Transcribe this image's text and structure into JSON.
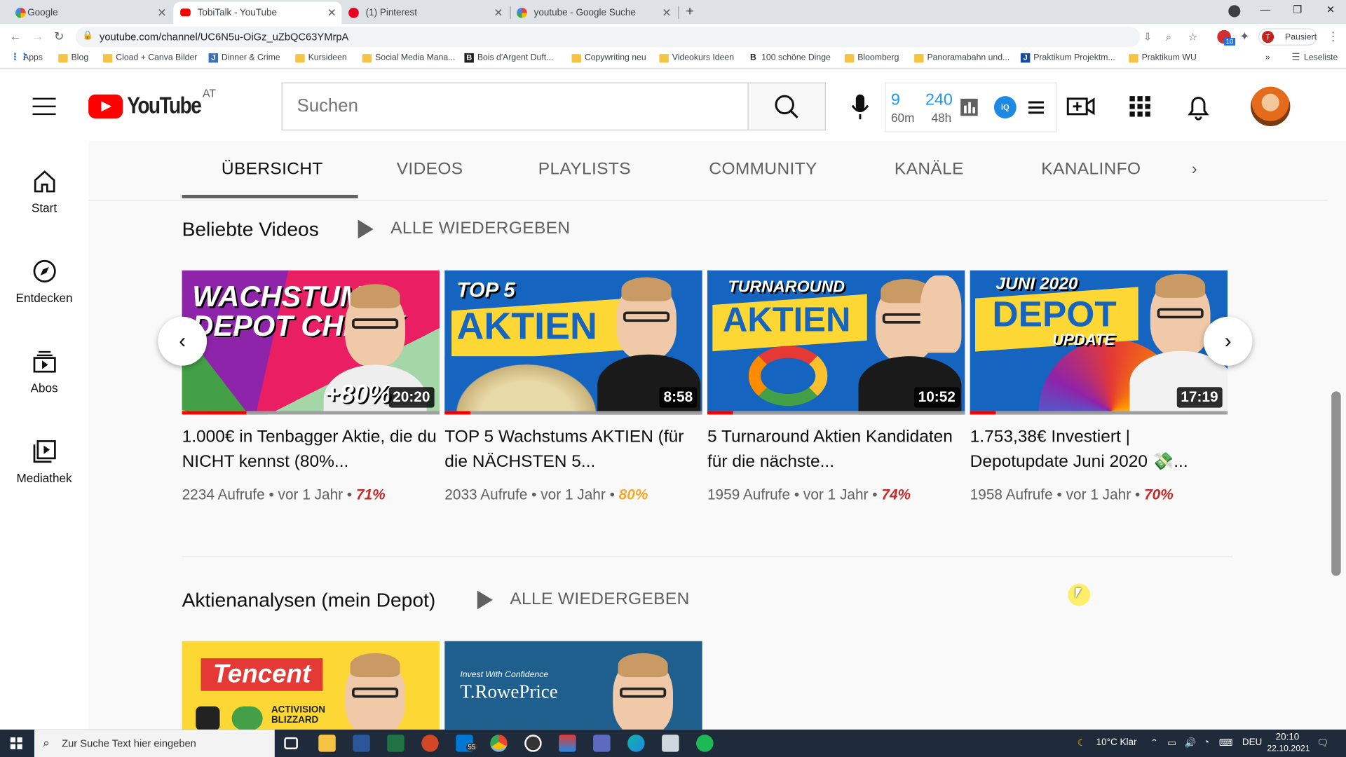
{
  "browser": {
    "tabs": [
      {
        "title": "Google"
      },
      {
        "title": "TobiTalk - YouTube"
      },
      {
        "title": "(1) Pinterest"
      },
      {
        "title": "youtube - Google Suche"
      }
    ],
    "url": "youtube.com/channel/UC6N5u-OiGz_uZbQC63YMrpA",
    "profile_initial": "T",
    "profile_status": "Pausiert",
    "extension_badge": "10",
    "bookmarks": [
      "Apps",
      "Blog",
      "Cload + Canva Bilder",
      "Dinner & Crime",
      "Kursideen",
      "Social Media Mana...",
      "Bois d'Argent Duft...",
      "Copywriting neu",
      "Videokurs Ideen",
      "100 schöne Dinge",
      "Bloomberg",
      "Panoramabahn und...",
      "Praktikum Projektm...",
      "Praktikum WU"
    ],
    "more_bookmarks": "»",
    "reading_list": "Leseliste"
  },
  "youtube": {
    "country_code": "AT",
    "logo_text": "YouTube",
    "search_placeholder": "Suchen",
    "ext_stats": {
      "v1": "9",
      "v1_unit": "60m",
      "v2": "240",
      "v2_unit": "48h"
    },
    "sidebar": [
      {
        "label": "Start",
        "icon": "home-icon"
      },
      {
        "label": "Entdecken",
        "icon": "compass-icon"
      },
      {
        "label": "Abos",
        "icon": "subscriptions-icon"
      },
      {
        "label": "Mediathek",
        "icon": "library-icon"
      }
    ],
    "channel_tabs": [
      "ÜBERSICHT",
      "VIDEOS",
      "PLAYLISTS",
      "COMMUNITY",
      "KANÄLE",
      "KANALINFO"
    ],
    "sections": [
      {
        "title": "Beliebte Videos",
        "play_all": "ALLE WIEDERGEBEN"
      },
      {
        "title": "Aktienanalysen (mein Depot)",
        "play_all": "ALLE WIEDERGEBEN"
      }
    ],
    "videos": [
      {
        "thumb_text": "WACHSTUMS DEPOT CHECK",
        "thumb_badge": "+80%",
        "duration": "20:20",
        "progress": 0.25,
        "title": "1.000€ in Tenbagger Aktie, die du NICHT kennst (80%...",
        "views": "2234 Aufrufe",
        "age": "vor 1 Jahr",
        "pct": "71%",
        "pct_color": "#c62828"
      },
      {
        "thumb_text": "TOP 5 AKTIEN",
        "duration": "8:58",
        "progress": 0.1,
        "title": "TOP 5 Wachstums AKTIEN (für die NÄCHSTEN 5...",
        "views": "2033 Aufrufe",
        "age": "vor 1 Jahr",
        "pct": "80%",
        "pct_color": "#f9a825"
      },
      {
        "thumb_text": "TURNAROUND AKTIEN",
        "duration": "10:52",
        "progress": 0.1,
        "title": "5 Turnaround Aktien Kandidaten für die nächste...",
        "views": "1959 Aufrufe",
        "age": "vor 1 Jahr",
        "pct": "74%",
        "pct_color": "#c62828"
      },
      {
        "thumb_text": "JUNI 2020 DEPOT UPDATE",
        "duration": "17:19",
        "progress": 0.1,
        "title": "1.753,38€ Investiert | Depotupdate Juni 2020 💸...",
        "views": "1958 Aufrufe",
        "age": "vor 1 Jahr",
        "pct": "70%",
        "pct_color": "#c62828"
      }
    ],
    "section2_thumbs": [
      {
        "thumb_text": "Tencent",
        "sub_text": "ACTIVISION BLIZZARD"
      },
      {
        "thumb_text": "T.RowePrice",
        "sub_text": "Invest With Confidence"
      }
    ],
    "meta_separator": "•"
  },
  "taskbar": {
    "search_placeholder": "Zur Suche Text hier eingeben",
    "mail_badge": "55",
    "weather": "10°C  Klar",
    "lang": "DEU",
    "time": "20:10",
    "date": "22.10.2021"
  }
}
